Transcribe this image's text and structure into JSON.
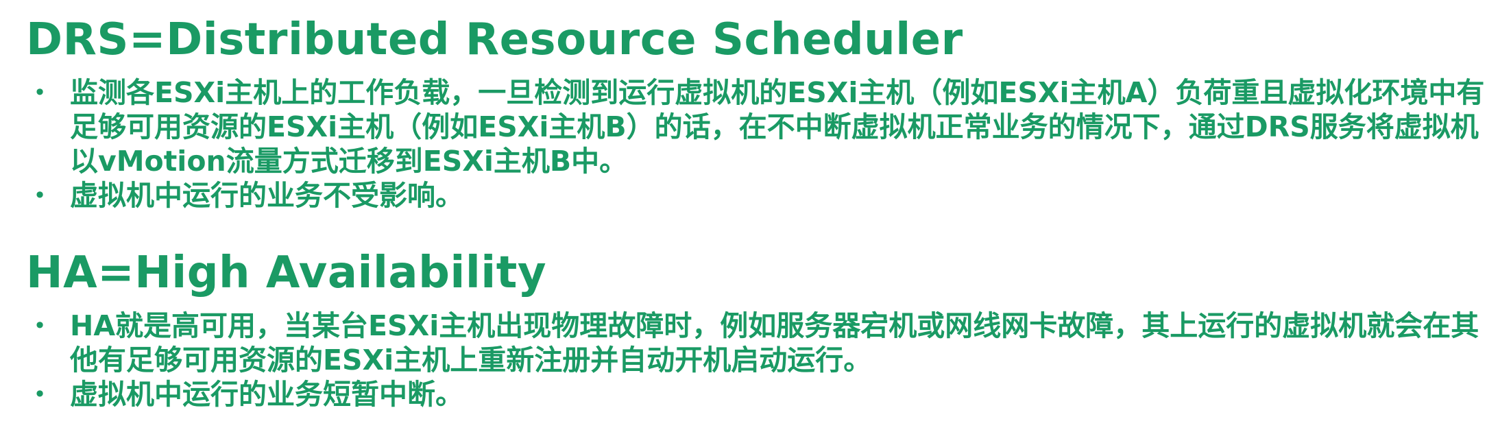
{
  "colors": {
    "heading": "#1a9a64",
    "body_text": "#1a9a64",
    "bullet": "#1a9a64",
    "background": "#ffffff"
  },
  "sections": [
    {
      "title": "DRS=Distributed Resource Scheduler",
      "bullets": [
        "监测各ESXi主机上的工作负载，一旦检测到运行虚拟机的ESXi主机（例如ESXi主机A）负荷重且虚拟化环境中有足够可用资源的ESXi主机（例如ESXi主机B）的话，在不中断虚拟机正常业务的情况下，通过DRS服务将虚拟机以vMotion流量方式迁移到ESXi主机B中。",
        "虚拟机中运行的业务不受影响。"
      ]
    },
    {
      "title": "HA=High Availability",
      "bullets": [
        "HA就是高可用，当某台ESXi主机出现物理故障时，例如服务器宕机或网线网卡故障，其上运行的虚拟机就会在其他有足够可用资源的ESXi主机上重新注册并自动开机启动运行。",
        "虚拟机中运行的业务短暂中断。"
      ]
    }
  ],
  "bullet_symbol": "•"
}
